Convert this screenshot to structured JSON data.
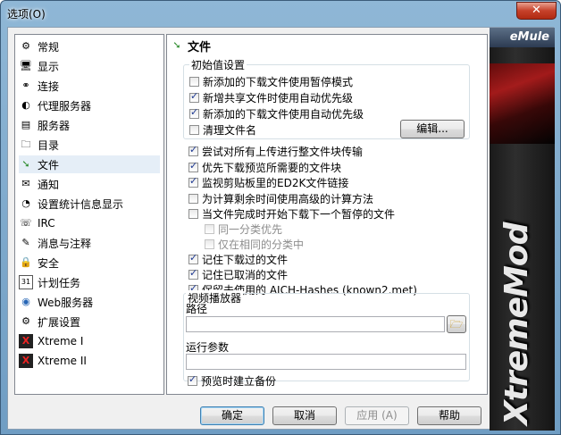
{
  "window": {
    "title": "选项(O)",
    "close_label": "✕"
  },
  "sidebar": {
    "items": [
      {
        "label": "常规",
        "icon": "gear-icon",
        "selected": false
      },
      {
        "label": "显示",
        "icon": "monitor-icon",
        "selected": false
      },
      {
        "label": "连接",
        "icon": "connection-icon",
        "selected": false
      },
      {
        "label": "代理服务器",
        "icon": "proxy-icon",
        "selected": false
      },
      {
        "label": "服务器",
        "icon": "server-icon",
        "selected": false
      },
      {
        "label": "目录",
        "icon": "folder-icon",
        "selected": false
      },
      {
        "label": "文件",
        "icon": "file-arrow-icon",
        "selected": true
      },
      {
        "label": "通知",
        "icon": "notify-icon",
        "selected": false
      },
      {
        "label": "设置统计信息显示",
        "icon": "stats-icon",
        "selected": false
      },
      {
        "label": "IRC",
        "icon": "irc-icon",
        "selected": false
      },
      {
        "label": "消息与注释",
        "icon": "message-icon",
        "selected": false
      },
      {
        "label": "安全",
        "icon": "lock-icon",
        "selected": false
      },
      {
        "label": "计划任务",
        "icon": "calendar-icon",
        "selected": false
      },
      {
        "label": "Web服务器",
        "icon": "globe-icon",
        "selected": false
      },
      {
        "label": "扩展设置",
        "icon": "extend-icon",
        "selected": false
      },
      {
        "label": "Xtreme I",
        "icon": "xtreme-icon",
        "selected": false
      },
      {
        "label": "Xtreme II",
        "icon": "xtreme-icon",
        "selected": false
      }
    ]
  },
  "panel": {
    "title": "文件",
    "group_init": {
      "title": "初始值设置",
      "options": [
        {
          "label": "新添加的下载文件使用暂停模式",
          "checked": false
        },
        {
          "label": "新增共享文件时使用自动优先级",
          "checked": true
        },
        {
          "label": "新添加的下载文件使用自动优先级",
          "checked": true
        },
        {
          "label": "清理文件名",
          "checked": false
        }
      ],
      "edit_button": "编辑..."
    },
    "options": [
      {
        "label": "尝试对所有上传进行整文件块传输",
        "checked": true,
        "disabled": false
      },
      {
        "label": "优先下载预览所需要的文件块",
        "checked": true,
        "disabled": false
      },
      {
        "label": "监视剪贴板里的ED2K文件链接",
        "checked": true,
        "disabled": false
      },
      {
        "label": "为计算剩余时间使用高级的计算方法",
        "checked": false,
        "disabled": false
      },
      {
        "label": "当文件完成时开始下载下一个暂停的文件",
        "checked": false,
        "disabled": false
      },
      {
        "label": "同一分类优先",
        "checked": false,
        "disabled": true
      },
      {
        "label": "仅在相同的分类中",
        "checked": false,
        "disabled": true
      },
      {
        "label": "记住下载过的文件",
        "checked": true,
        "disabled": false
      },
      {
        "label": "记住已取消的文件",
        "checked": true,
        "disabled": false
      },
      {
        "label": "保留未使用的 AICH-Hashes (known2.met)",
        "checked": true,
        "disabled": false
      }
    ],
    "group_player": {
      "title": "视频播放器",
      "path_label": "路径",
      "path_value": "",
      "args_label": "运行参数",
      "args_value": "",
      "backup_label": "预览时建立备份",
      "backup_checked": true
    }
  },
  "buttons": {
    "ok": "确定",
    "cancel": "取消",
    "apply": "应用 (A)",
    "help": "帮助"
  },
  "banner": {
    "brand": "eMule",
    "mod": "XtremeMod"
  },
  "colors": {
    "selected_bg": "#e5eef7",
    "check_color": "#1f3a93",
    "close_red": "#c6412a"
  }
}
